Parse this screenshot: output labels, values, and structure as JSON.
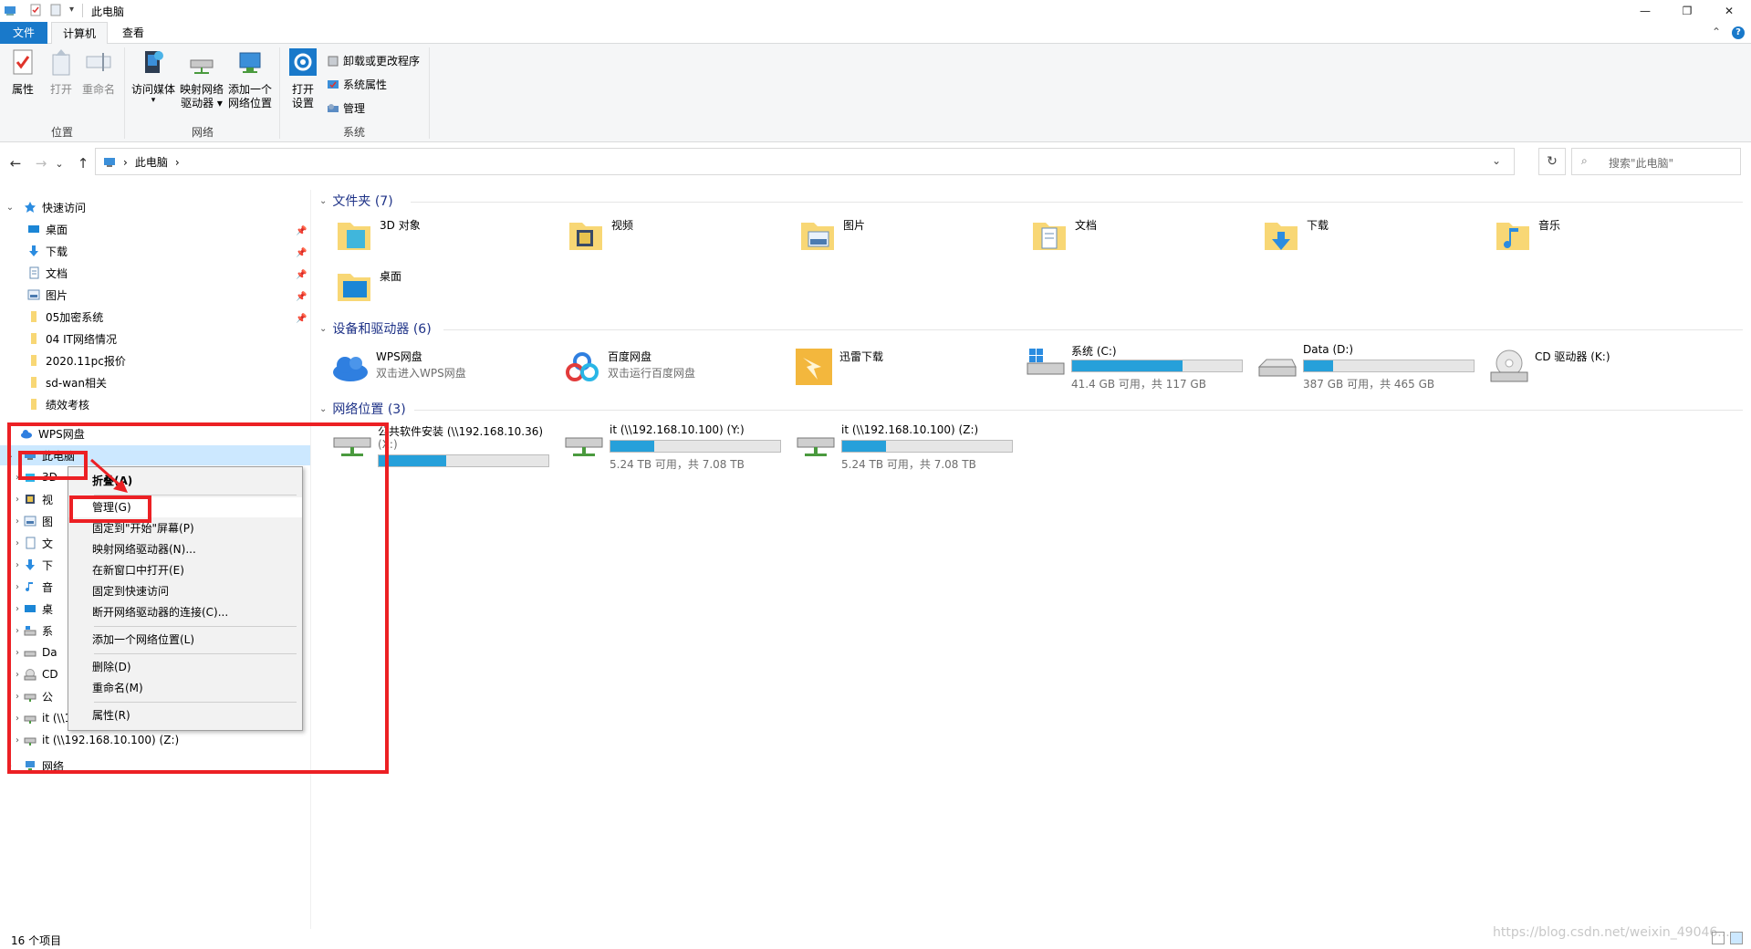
{
  "window": {
    "title": "此电脑",
    "minimize": "—",
    "restore": "❐",
    "close": "✕",
    "quick_access_dropdown": "▾"
  },
  "ribbon": {
    "tabs": [
      "文件",
      "计算机",
      "查看"
    ],
    "collapse": "⌃",
    "help": "?",
    "location_group": {
      "label": "位置",
      "buttons": [
        "属性",
        "打开",
        "重命名"
      ]
    },
    "network_group": {
      "label": "网络",
      "buttons": [
        {
          "line1": "访问媒体",
          "line2": "▾"
        },
        {
          "line1": "映射网络",
          "line2": "驱动器 ▾"
        },
        {
          "line1": "添加一个",
          "line2": "网络位置"
        }
      ]
    },
    "system_group": {
      "label": "系统",
      "open_settings": {
        "line1": "打开",
        "line2": "设置"
      },
      "small_buttons": [
        "卸载或更改程序",
        "系统属性",
        "管理"
      ]
    }
  },
  "nav": {
    "back": "←",
    "forward": "→",
    "recent": "⌄",
    "up": "↑",
    "breadcrumb": [
      "›",
      "此电脑",
      "›"
    ],
    "address_dropdown": "⌄",
    "refresh": "↻",
    "search_placeholder": "搜索\"此电脑\""
  },
  "navpane": {
    "quick_access": "快速访问",
    "quick_items": [
      "桌面",
      "下载",
      "文档",
      "图片",
      "05加密系统",
      "04 IT网络情况",
      "2020.11pc报价",
      "sd-wan相关",
      "绩效考核"
    ],
    "wps": "WPS网盘",
    "this_pc": "此电脑",
    "pc_children": [
      "3D",
      "视",
      "图",
      "文",
      "下",
      "音",
      "桌",
      "系",
      "Da",
      "CD",
      "公",
      "it (\\\\192.168.10.100) (Y:)",
      "it (\\\\192.168.10.100) (Z:)"
    ],
    "network": "网络"
  },
  "content": {
    "folders_header": "文件夹 (7)",
    "folders": [
      "3D 对象",
      "视频",
      "图片",
      "文档",
      "下载",
      "音乐",
      "桌面"
    ],
    "devices_header": "设备和驱动器 (6)",
    "devices": [
      {
        "name": "WPS网盘",
        "sub": "双击进入WPS网盘"
      },
      {
        "name": "百度网盘",
        "sub": "双击运行百度网盘"
      },
      {
        "name": "迅雷下载",
        "sub": ""
      },
      {
        "name": "系统 (C:)",
        "usage": 0.65,
        "sub": "41.4 GB 可用，共 117 GB"
      },
      {
        "name": "Data (D:)",
        "usage": 0.17,
        "sub": "387 GB 可用，共 465 GB"
      },
      {
        "name": "CD 驱动器 (K:)",
        "sub": ""
      }
    ],
    "network_header": "网络位置 (3)",
    "network": [
      {
        "name": "公共软件安装 (\\\\192.168.10.36)",
        "name2": "(X:)",
        "usage": 0.4,
        "sub": ""
      },
      {
        "name": "it (\\\\192.168.10.100) (Y:)",
        "usage": 0.26,
        "sub": "5.24 TB 可用，共 7.08 TB"
      },
      {
        "name": "it (\\\\192.168.10.100) (Z:)",
        "usage": 0.26,
        "sub": "5.24 TB 可用，共 7.08 TB"
      }
    ]
  },
  "context_menu": {
    "items": [
      "折叠(A)",
      "管理(G)",
      "固定到\"开始\"屏幕(P)",
      "映射网络驱动器(N)...",
      "在新窗口中打开(E)",
      "固定到快速访问",
      "断开网络驱动器的连接(C)...",
      "添加一个网络位置(L)",
      "删除(D)",
      "重命名(M)",
      "属性(R)"
    ]
  },
  "status": {
    "count": "16 个项目",
    "watermark": "https://blog.csdn.net/weixin_49046..."
  },
  "colors": {
    "accent": "#1979ca",
    "bar_fill": "#26a0da",
    "annotation_red": "#ec2024",
    "section_blue": "#1e3287"
  }
}
